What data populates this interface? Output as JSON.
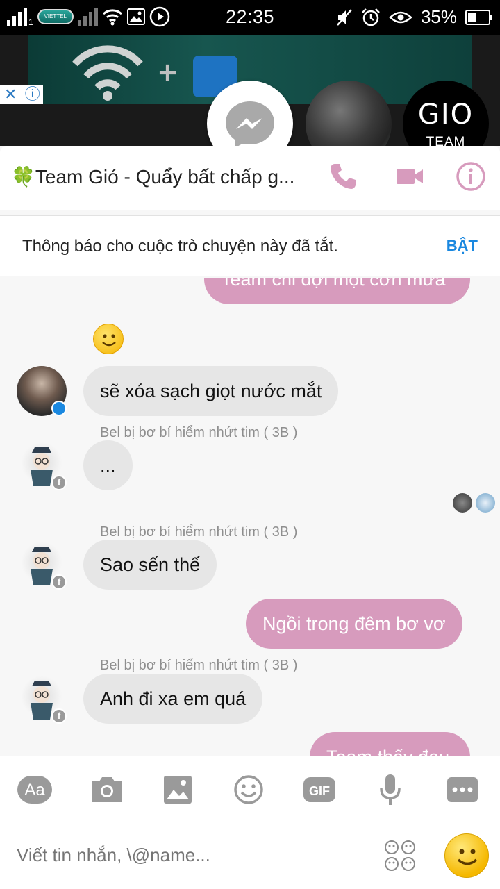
{
  "status_bar": {
    "carrier": "VIETTEL",
    "sim_number": "1",
    "time": "22:35",
    "battery": "35%"
  },
  "chat_heads": {
    "gio_logo_text": "GIO",
    "gio_team_text": "TEAM"
  },
  "header": {
    "title": "Team Gió - Quẩy bất chấp g...",
    "clover": "🍀"
  },
  "notice": {
    "text": "Thông báo cho cuộc trò chuyện này đã tắt.",
    "button": "BẬT"
  },
  "messages": [
    {
      "side": "out",
      "text": "Team chỉ đợi một cơn mưa"
    },
    {
      "side": "in",
      "text": "sẽ xóa sạch giọt nước mắt"
    },
    {
      "side": "in",
      "sender": "Bel bị bơ bí hiểm nhứt tim ( 3B )",
      "text": "..."
    },
    {
      "side": "in",
      "sender": "Bel bị bơ bí hiểm nhứt tim ( 3B )",
      "text": "Sao sến thế"
    },
    {
      "side": "out",
      "text": "Ngồi trong đêm bơ vơ"
    },
    {
      "side": "in",
      "sender": "Bel bị bơ bí hiểm nhứt tim ( 3B )",
      "text": "Anh đi xa em quá"
    },
    {
      "side": "out",
      "text": "Team thấy đau"
    }
  ],
  "toolbar": {
    "text_icon_label": "Aa",
    "gif_label": "GIF"
  },
  "composer": {
    "placeholder": "Viết tin nhắn, \\@name..."
  },
  "colors": {
    "accent": "#d79bbd",
    "link_blue": "#1a88e0",
    "incoming_bubble": "#e6e6e6"
  }
}
